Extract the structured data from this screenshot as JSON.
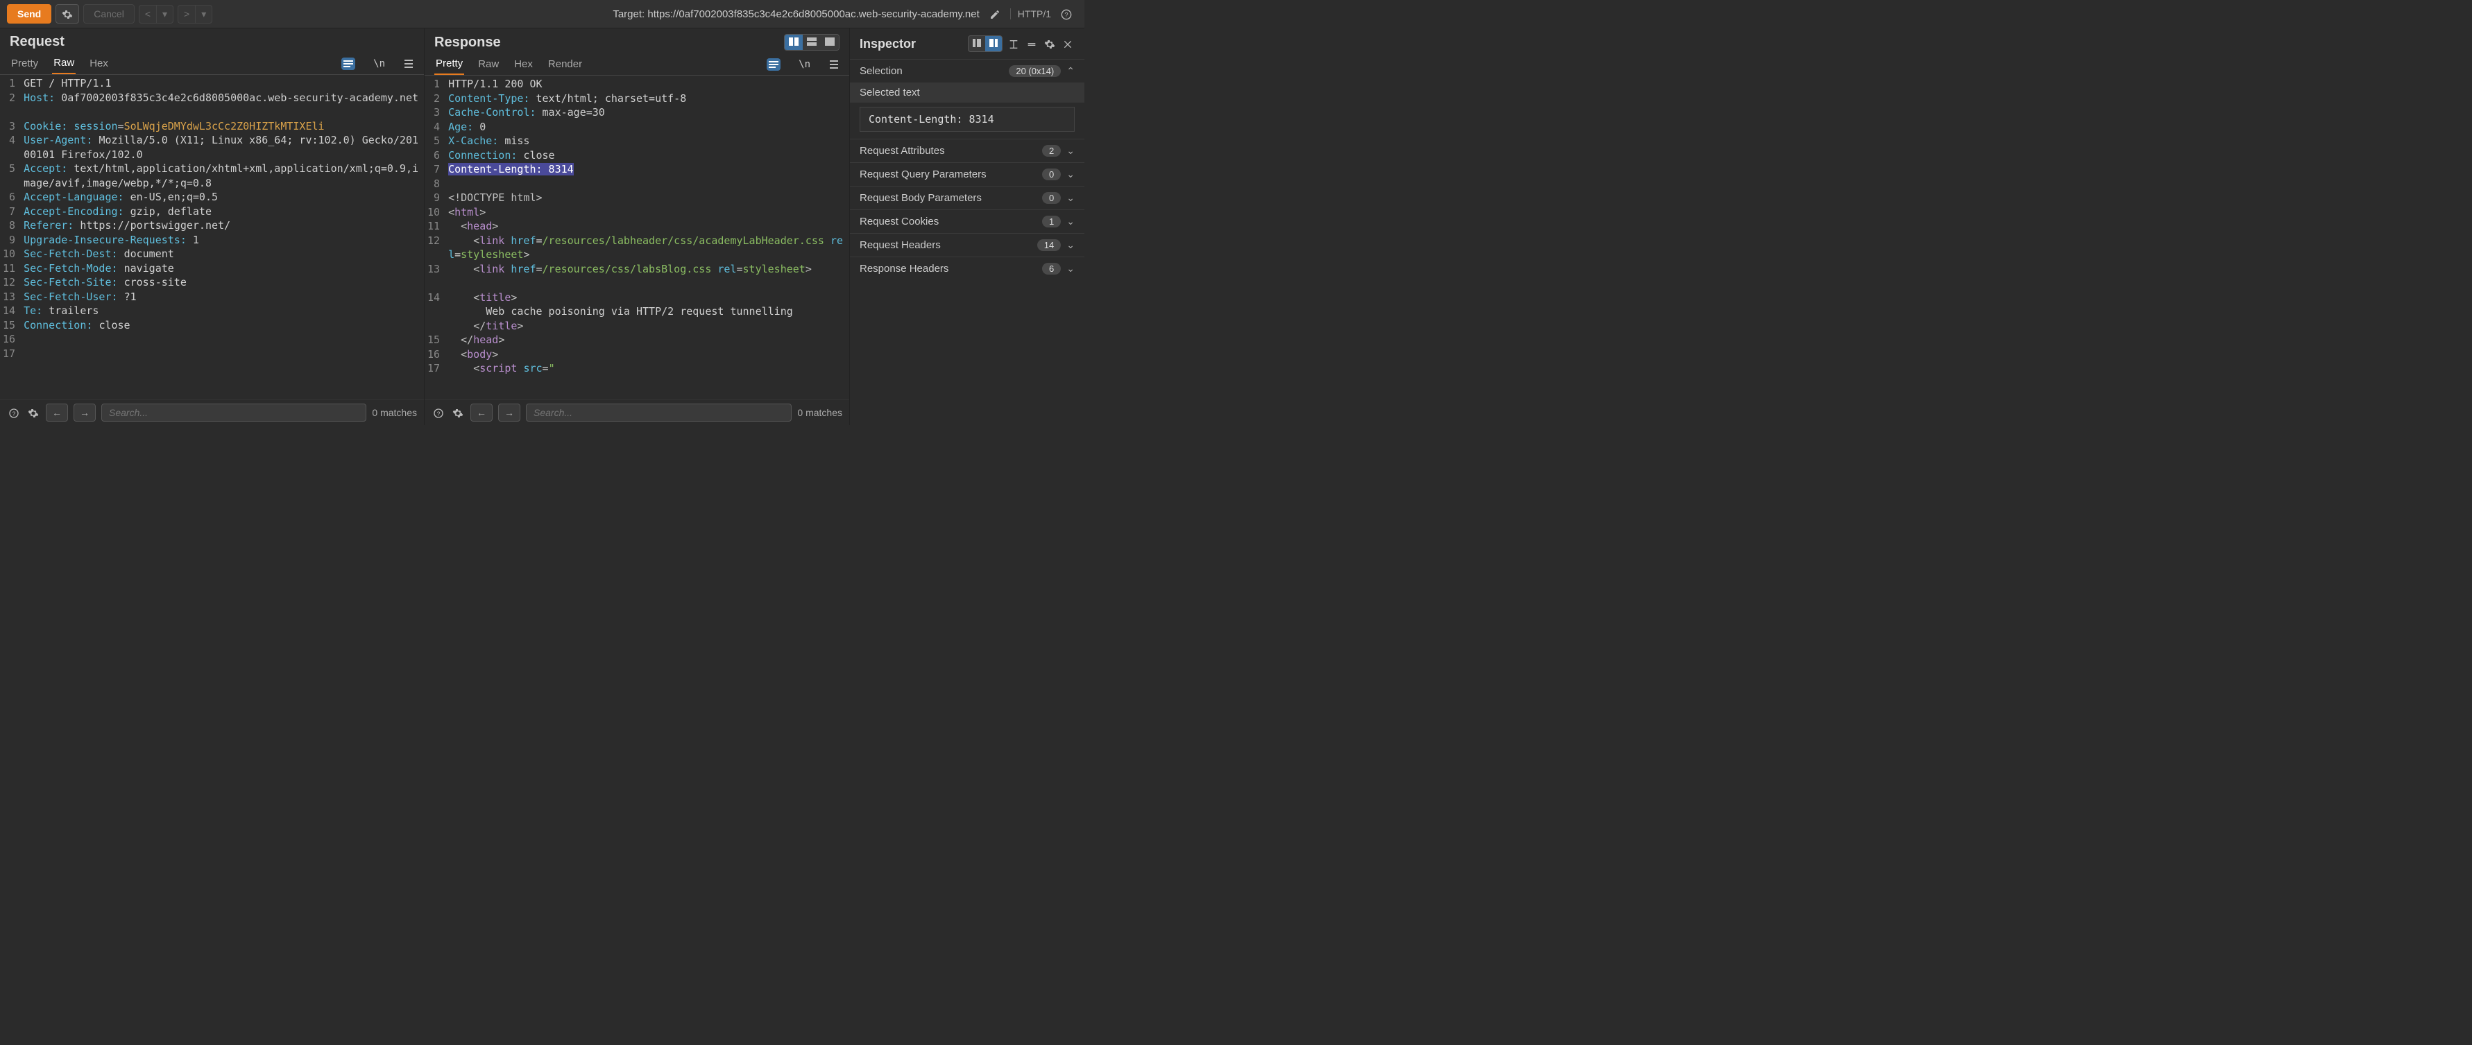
{
  "toolbar": {
    "send_label": "Send",
    "cancel_label": "Cancel",
    "target_prefix": "Target: ",
    "target_url": "https://0af7002003f835c3c4e2c6d8005000ac.web-security-academy.net",
    "http_version": "HTTP/1"
  },
  "request": {
    "title": "Request",
    "tabs": [
      "Pretty",
      "Raw",
      "Hex"
    ],
    "active_tab": "Raw",
    "lines": [
      {
        "n": 1,
        "segments": [
          {
            "t": "GET / HTTP/1.1",
            "cls": "val"
          }
        ]
      },
      {
        "n": 2,
        "segments": [
          {
            "t": "Host: ",
            "cls": "hdr"
          },
          {
            "t": "0af7002003f835c3c4e2c6d8005000ac.web-security-academy.net",
            "cls": "val"
          }
        ]
      },
      {
        "n": 3,
        "segments": [
          {
            "t": "Cookie: ",
            "cls": "hdr"
          },
          {
            "t": "session",
            "cls": "hdr"
          },
          {
            "t": "=",
            "cls": "val"
          },
          {
            "t": "SoLWqjeDMYdwL3cCc2Z0HIZTkMTIXEli",
            "cls": "orange"
          }
        ]
      },
      {
        "n": 4,
        "segments": [
          {
            "t": "User-Agent: ",
            "cls": "hdr"
          },
          {
            "t": "Mozilla/5.0 (X11; Linux x86_64; rv:102.0) Gecko/20100101 Firefox/102.0",
            "cls": "val"
          }
        ]
      },
      {
        "n": 5,
        "segments": [
          {
            "t": "Accept: ",
            "cls": "hdr"
          },
          {
            "t": "text/html,application/xhtml+xml,application/xml;q=0.9,image/avif,image/webp,*/*;q=0.8",
            "cls": "val"
          }
        ]
      },
      {
        "n": 6,
        "segments": [
          {
            "t": "Accept-Language: ",
            "cls": "hdr"
          },
          {
            "t": "en-US,en;q=0.5",
            "cls": "val"
          }
        ]
      },
      {
        "n": 7,
        "segments": [
          {
            "t": "Accept-Encoding: ",
            "cls": "hdr"
          },
          {
            "t": "gzip, deflate",
            "cls": "val"
          }
        ]
      },
      {
        "n": 8,
        "segments": [
          {
            "t": "Referer: ",
            "cls": "hdr"
          },
          {
            "t": "https://portswigger.net/",
            "cls": "val"
          }
        ]
      },
      {
        "n": 9,
        "segments": [
          {
            "t": "Upgrade-Insecure-Requests: ",
            "cls": "hdr"
          },
          {
            "t": "1",
            "cls": "val"
          }
        ]
      },
      {
        "n": 10,
        "segments": [
          {
            "t": "Sec-Fetch-Dest: ",
            "cls": "hdr"
          },
          {
            "t": "document",
            "cls": "val"
          }
        ]
      },
      {
        "n": 11,
        "segments": [
          {
            "t": "Sec-Fetch-Mode: ",
            "cls": "hdr"
          },
          {
            "t": "navigate",
            "cls": "val"
          }
        ]
      },
      {
        "n": 12,
        "segments": [
          {
            "t": "Sec-Fetch-Site: ",
            "cls": "hdr"
          },
          {
            "t": "cross-site",
            "cls": "val"
          }
        ]
      },
      {
        "n": 13,
        "segments": [
          {
            "t": "Sec-Fetch-User: ",
            "cls": "hdr"
          },
          {
            "t": "?1",
            "cls": "val"
          }
        ]
      },
      {
        "n": 14,
        "segments": [
          {
            "t": "Te: ",
            "cls": "hdr"
          },
          {
            "t": "trailers",
            "cls": "val"
          }
        ]
      },
      {
        "n": 15,
        "segments": [
          {
            "t": "Connection: ",
            "cls": "hdr"
          },
          {
            "t": "close",
            "cls": "val"
          }
        ]
      },
      {
        "n": 16,
        "segments": []
      },
      {
        "n": 17,
        "segments": []
      }
    ],
    "search_placeholder": "Search...",
    "search_matches": "0 matches"
  },
  "response": {
    "title": "Response",
    "tabs": [
      "Pretty",
      "Raw",
      "Hex",
      "Render"
    ],
    "active_tab": "Pretty",
    "lines": [
      {
        "n": 1,
        "segments": [
          {
            "t": "HTTP/1.1 200 OK",
            "cls": "val"
          }
        ]
      },
      {
        "n": 2,
        "segments": [
          {
            "t": "Content-Type:",
            "cls": "hdr"
          },
          {
            "t": " text/html; charset=utf-8",
            "cls": "val"
          }
        ]
      },
      {
        "n": 3,
        "segments": [
          {
            "t": "Cache-Control:",
            "cls": "hdr"
          },
          {
            "t": " max-age=30",
            "cls": "val"
          }
        ]
      },
      {
        "n": 4,
        "segments": [
          {
            "t": "Age:",
            "cls": "hdr"
          },
          {
            "t": " 0",
            "cls": "val"
          }
        ]
      },
      {
        "n": 5,
        "segments": [
          {
            "t": "X-Cache:",
            "cls": "hdr"
          },
          {
            "t": " miss",
            "cls": "val"
          }
        ]
      },
      {
        "n": 6,
        "segments": [
          {
            "t": "Connection:",
            "cls": "hdr"
          },
          {
            "t": " close",
            "cls": "val"
          }
        ]
      },
      {
        "n": 7,
        "segments": [
          {
            "t": "Content-Length: 8314",
            "cls": "sel"
          }
        ]
      },
      {
        "n": 8,
        "segments": []
      },
      {
        "n": 9,
        "segments": [
          {
            "t": "<!DOCTYPE html>",
            "cls": "tagbr"
          }
        ]
      },
      {
        "n": 10,
        "segments": [
          {
            "t": "<",
            "cls": "tagbr"
          },
          {
            "t": "html",
            "cls": "purple"
          },
          {
            "t": ">",
            "cls": "tagbr"
          }
        ]
      },
      {
        "n": 11,
        "indent": 2,
        "segments": [
          {
            "t": "<",
            "cls": "tagbr"
          },
          {
            "t": "head",
            "cls": "purple"
          },
          {
            "t": ">",
            "cls": "tagbr"
          }
        ]
      },
      {
        "n": 12,
        "indent": 4,
        "segments": [
          {
            "t": "<",
            "cls": "tagbr"
          },
          {
            "t": "link",
            "cls": "purple"
          },
          {
            "t": " ",
            "cls": "val"
          },
          {
            "t": "href",
            "cls": "hdr"
          },
          {
            "t": "=",
            "cls": "val"
          },
          {
            "t": "/resources/labheader/css/academyLabHeader.css",
            "cls": "green"
          },
          {
            "t": " ",
            "cls": "val"
          },
          {
            "t": "rel",
            "cls": "hdr"
          },
          {
            "t": "=",
            "cls": "val"
          },
          {
            "t": "stylesheet",
            "cls": "green"
          },
          {
            "t": ">",
            "cls": "tagbr"
          }
        ]
      },
      {
        "n": 13,
        "indent": 4,
        "segments": [
          {
            "t": "<",
            "cls": "tagbr"
          },
          {
            "t": "link",
            "cls": "purple"
          },
          {
            "t": " ",
            "cls": "val"
          },
          {
            "t": "href",
            "cls": "hdr"
          },
          {
            "t": "=",
            "cls": "val"
          },
          {
            "t": "/resources/css/labsBlog.css",
            "cls": "green"
          },
          {
            "t": " ",
            "cls": "val"
          },
          {
            "t": "rel",
            "cls": "hdr"
          },
          {
            "t": "=",
            "cls": "val"
          },
          {
            "t": "stylesheet",
            "cls": "green"
          },
          {
            "t": ">",
            "cls": "tagbr"
          }
        ]
      },
      {
        "n": 14,
        "indent": 4,
        "segments": [
          {
            "t": "<",
            "cls": "tagbr"
          },
          {
            "t": "title",
            "cls": "purple"
          },
          {
            "t": ">",
            "cls": "tagbr"
          }
        ]
      },
      {
        "n": "",
        "indent": 6,
        "segments": [
          {
            "t": "Web cache poisoning via HTTP/2 request tunnelling",
            "cls": "val"
          }
        ]
      },
      {
        "n": "",
        "indent": 4,
        "segments": [
          {
            "t": "</",
            "cls": "tagbr"
          },
          {
            "t": "title",
            "cls": "purple"
          },
          {
            "t": ">",
            "cls": "tagbr"
          }
        ]
      },
      {
        "n": 15,
        "indent": 2,
        "segments": [
          {
            "t": "</",
            "cls": "tagbr"
          },
          {
            "t": "head",
            "cls": "purple"
          },
          {
            "t": ">",
            "cls": "tagbr"
          }
        ]
      },
      {
        "n": 16,
        "indent": 2,
        "segments": [
          {
            "t": "<",
            "cls": "tagbr"
          },
          {
            "t": "body",
            "cls": "purple"
          },
          {
            "t": ">",
            "cls": "tagbr"
          }
        ]
      },
      {
        "n": 17,
        "indent": 4,
        "segments": [
          {
            "t": "<",
            "cls": "tagbr"
          },
          {
            "t": "script",
            "cls": "purple"
          },
          {
            "t": " ",
            "cls": "val"
          },
          {
            "t": "src",
            "cls": "hdr"
          },
          {
            "t": "=",
            "cls": "val"
          },
          {
            "t": "\"",
            "cls": "green"
          }
        ]
      }
    ],
    "search_placeholder": "Search...",
    "search_matches": "0 matches"
  },
  "inspector": {
    "title": "Inspector",
    "selection": {
      "label": "Selection",
      "badge": "20 (0x14)",
      "subtitle": "Selected text",
      "value": "Content-Length: 8314"
    },
    "sections": [
      {
        "label": "Request Attributes",
        "badge": "2"
      },
      {
        "label": "Request Query Parameters",
        "badge": "0"
      },
      {
        "label": "Request Body Parameters",
        "badge": "0"
      },
      {
        "label": "Request Cookies",
        "badge": "1"
      },
      {
        "label": "Request Headers",
        "badge": "14"
      },
      {
        "label": "Response Headers",
        "badge": "6"
      }
    ]
  }
}
